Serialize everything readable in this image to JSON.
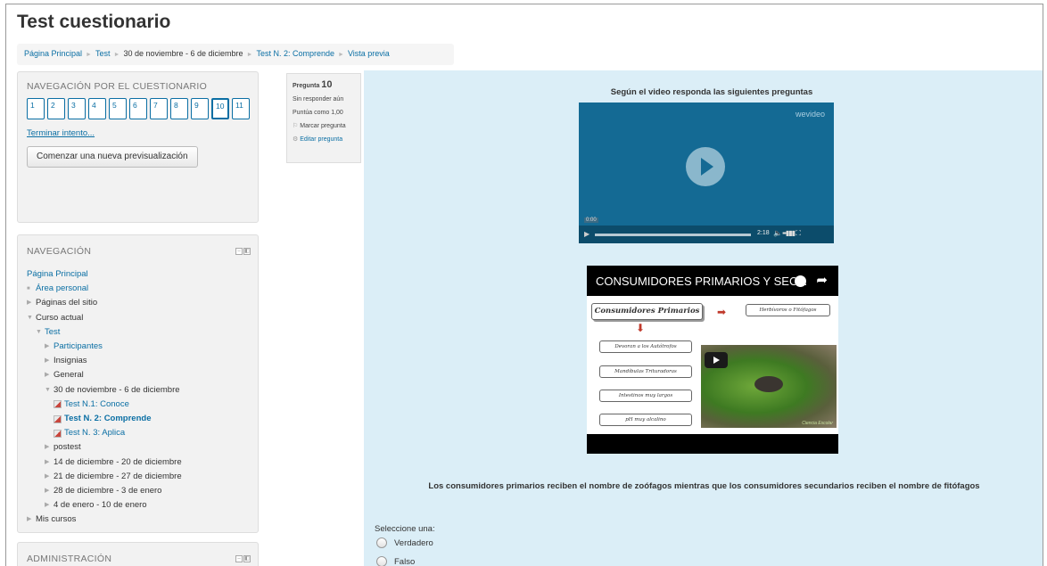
{
  "page": {
    "title": "Test cuestionario"
  },
  "breadcrumb": [
    "Página Principal",
    "Test",
    "30 de noviembre - 6 de diciembre",
    "Test N. 2: Comprende",
    "Vista previa"
  ],
  "quiz_nav": {
    "header": "NAVEGACIÓN POR EL CUESTIONARIO",
    "questions": [
      "1",
      "2",
      "3",
      "4",
      "5",
      "6",
      "7",
      "8",
      "9",
      "10",
      "11"
    ],
    "current": "10",
    "finish_link": "Terminar intento...",
    "new_preview_button": "Comenzar una nueva previsualización"
  },
  "navigation": {
    "header": "NAVEGACIÓN",
    "items": [
      {
        "label": "Página Principal",
        "indent": 0,
        "marker": "none",
        "link": true
      },
      {
        "label": "Área personal",
        "indent": 0,
        "marker": "bullet",
        "link": true
      },
      {
        "label": "Páginas del sitio",
        "indent": 0,
        "marker": "closed"
      },
      {
        "label": "Curso actual",
        "indent": 0,
        "marker": "open"
      },
      {
        "label": "Test",
        "indent": 1,
        "marker": "open",
        "link": true
      },
      {
        "label": "Participantes",
        "indent": 2,
        "marker": "closed",
        "link": true
      },
      {
        "label": "Insignias",
        "indent": 2,
        "marker": "closed"
      },
      {
        "label": "General",
        "indent": 2,
        "marker": "closed"
      },
      {
        "label": "30 de noviembre - 6 de diciembre",
        "indent": 2,
        "marker": "open"
      },
      {
        "label": "Test N.1: Conoce",
        "indent": 3,
        "marker": "quiz",
        "link": true
      },
      {
        "label": "Test N. 2: Comprende",
        "indent": 3,
        "marker": "quiz",
        "link": true,
        "bold": true
      },
      {
        "label": "Test N. 3: Aplica",
        "indent": 3,
        "marker": "quiz",
        "link": true
      },
      {
        "label": "postest",
        "indent": 2,
        "marker": "closed"
      },
      {
        "label": "14 de diciembre - 20 de diciembre",
        "indent": 2,
        "marker": "closed"
      },
      {
        "label": "21 de diciembre - 27 de diciembre",
        "indent": 2,
        "marker": "closed"
      },
      {
        "label": "28 de diciembre - 3 de enero",
        "indent": 2,
        "marker": "closed"
      },
      {
        "label": "4 de enero - 10 de enero",
        "indent": 2,
        "marker": "closed"
      },
      {
        "label": "Mis cursos",
        "indent": 0,
        "marker": "closed"
      }
    ]
  },
  "admin": {
    "header": "ADMINISTRACIÓN"
  },
  "question_info": {
    "label": "Pregunta",
    "number": "10",
    "status": "Sin responder aún",
    "score": "Puntúa como 1,00",
    "flag": "Marcar pregunta",
    "edit": "Editar pregunta"
  },
  "question": {
    "instruction": "Según el video responda las siguientes preguntas",
    "video": {
      "brand": "wevideo",
      "time": "0:00",
      "duration": "2:18"
    },
    "youtube": {
      "title": "CONSUMIDORES PRIMARIOS Y SEC...",
      "slide": {
        "main": "Consumidores Primarios",
        "side": "Herbívoros o Fitófagos",
        "items": [
          "Devoran a los Autótrofos",
          "Mandíbulas Trituradoras",
          "Intestinos muy largos",
          "pH muy alcalino"
        ],
        "credit": "Ciencia Escolar"
      }
    },
    "statement": "Los consumidores primarios reciben el nombre de zoófagos mientras que los consumidores secundarios reciben el nombre de fitófagos",
    "select_label": "Seleccione una:",
    "options": [
      "Verdadero",
      "Falso"
    ]
  },
  "colors": {
    "link": "#0b6fa4",
    "content_bg": "#dbeef7",
    "block_bg": "#f2f2f2"
  }
}
